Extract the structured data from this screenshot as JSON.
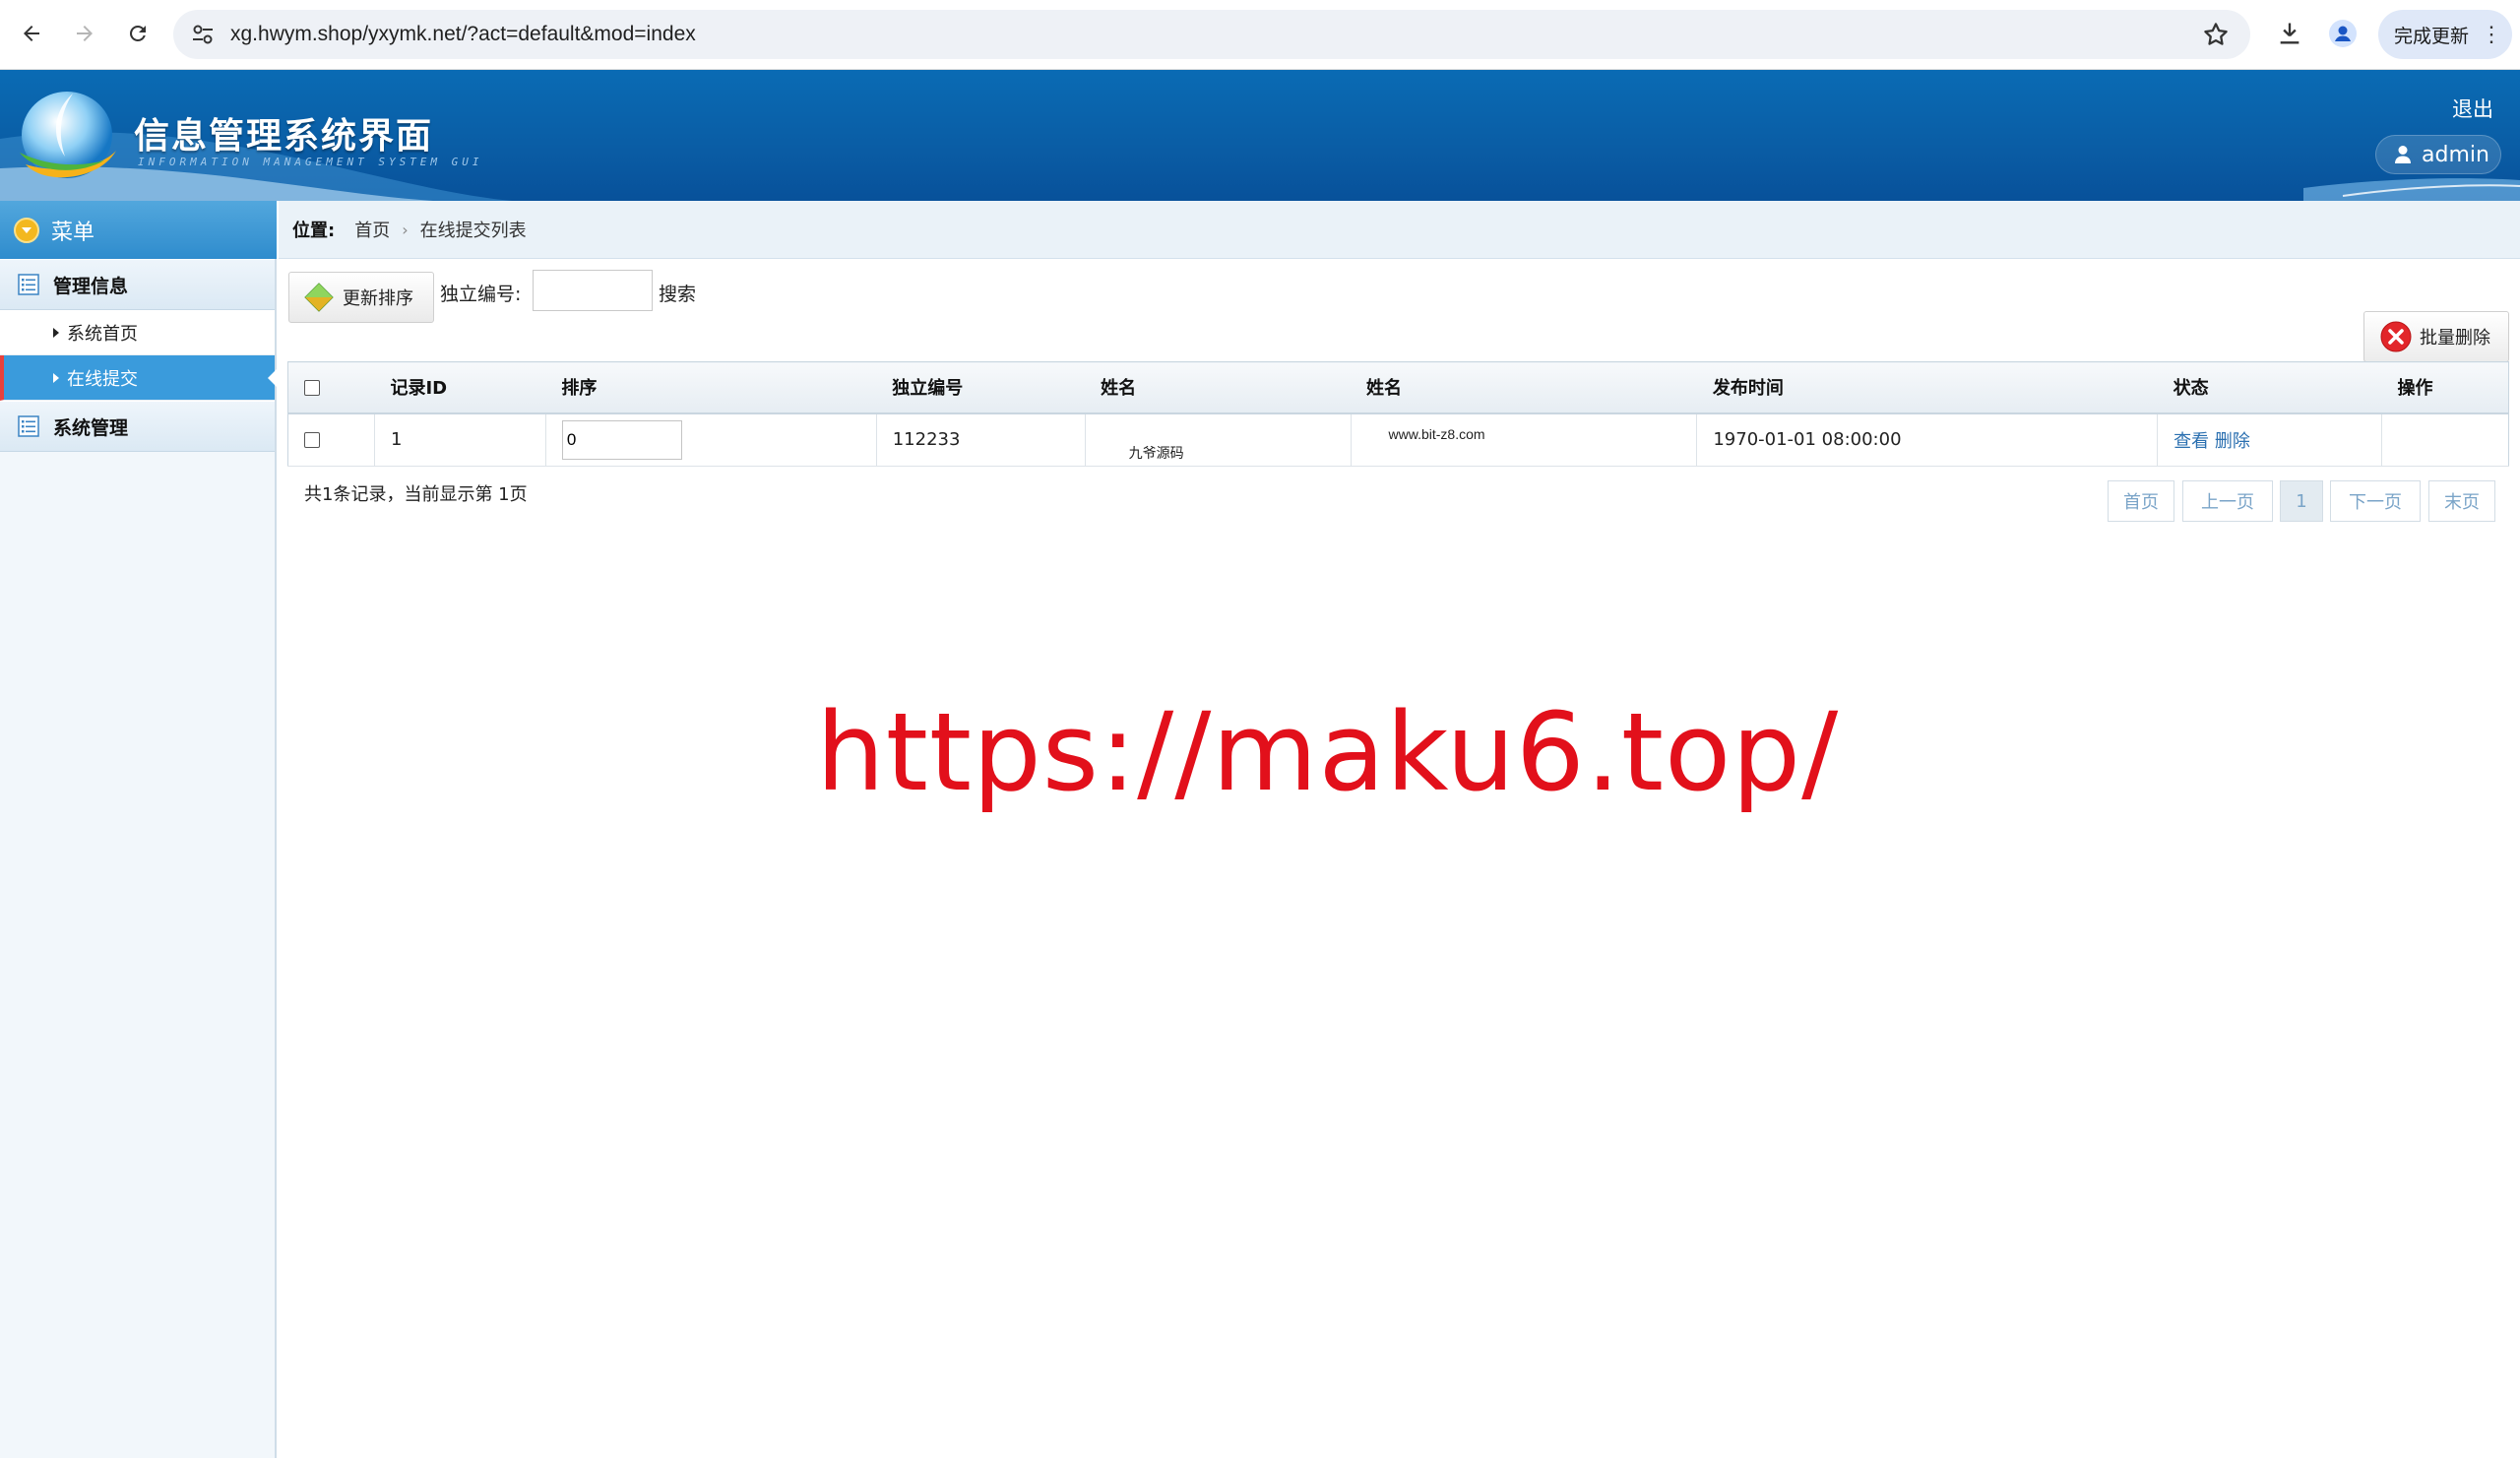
{
  "browser": {
    "url": "xg.hwym.shop/yxymk.net/?act=default&mod=index",
    "update_button": "完成更新"
  },
  "header": {
    "title": "信息管理系统界面",
    "subtitle": "INFORMATION MANAGEMENT SYSTEM GUI",
    "logout": "退出",
    "user": "admin",
    "colors": {
      "header_blue": "#0a6bb4",
      "accent": "#3a9bdc"
    }
  },
  "sidebar": {
    "menu_title": "菜单",
    "groups": [
      {
        "label": "管理信息",
        "items": [
          {
            "label": "系统首页"
          },
          {
            "label": "在线提交",
            "active": true
          }
        ]
      },
      {
        "label": "系统管理",
        "items": []
      }
    ]
  },
  "breadcrumb": {
    "label": "位置:",
    "items": [
      "首页",
      "在线提交列表"
    ]
  },
  "toolbar": {
    "update_sort": "更新排序",
    "search_label": "独立编号:",
    "search_value": "",
    "search_button": "搜索",
    "batch_delete": "批量删除"
  },
  "table": {
    "headers": [
      "记录ID",
      "排序",
      "独立编号",
      "姓名",
      "姓名",
      "发布时间",
      "状态",
      "操作"
    ],
    "rows": [
      {
        "id": "1",
        "sort": "0",
        "code": "112233",
        "name1": "九爷源码",
        "name2": "www.bit-z8.com",
        "time": "1970-01-01 08:00:00",
        "view": "查看",
        "delete": "删除"
      }
    ]
  },
  "footer": {
    "count_text": "共1条记录，当前显示第 1页"
  },
  "pager": {
    "first": "首页",
    "prev": "上一页",
    "current": "1",
    "next": "下一页",
    "last": "末页"
  },
  "watermark": {
    "text": "https://maku6.top/",
    "color": "#e2101b"
  }
}
